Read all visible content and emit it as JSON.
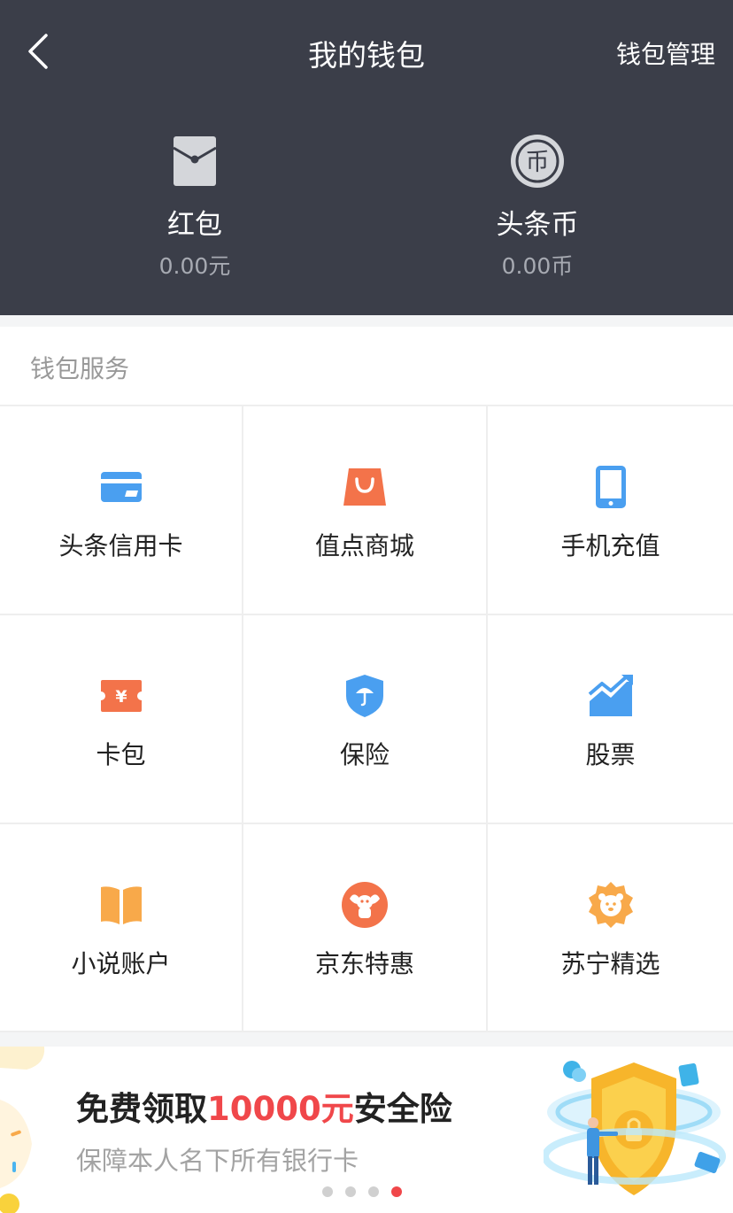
{
  "header": {
    "title": "我的钱包",
    "manage_label": "钱包管理",
    "red_packet": {
      "name": "红包",
      "value": "0.00元"
    },
    "coin": {
      "name": "头条币",
      "value": "0.00币",
      "icon_glyph": "币"
    }
  },
  "services": {
    "title": "钱包服务",
    "items": [
      {
        "label": "头条信用卡",
        "icon": "credit-card-icon",
        "color": "#4a9ff0"
      },
      {
        "label": "值点商城",
        "icon": "shopping-bag-icon",
        "color": "#f3734a"
      },
      {
        "label": "手机充值",
        "icon": "phone-icon",
        "color": "#4a9ff0"
      },
      {
        "label": "卡包",
        "icon": "coupon-icon",
        "color": "#f3734a",
        "glyph": "¥"
      },
      {
        "label": "保险",
        "icon": "shield-umbrella-icon",
        "color": "#4a9ff0"
      },
      {
        "label": "股票",
        "icon": "stock-chart-icon",
        "color": "#4a9ff0"
      },
      {
        "label": "小说账户",
        "icon": "book-icon",
        "color": "#f8a94a"
      },
      {
        "label": "京东特惠",
        "icon": "jd-dog-icon",
        "color": "#f3734a"
      },
      {
        "label": "苏宁精选",
        "icon": "suning-lion-icon",
        "color": "#f8a94a"
      }
    ]
  },
  "banner": {
    "title_prefix": "免费领取",
    "title_highlight": "10000元",
    "title_suffix": "安全险",
    "subtitle": "保障本人名下所有银行卡",
    "dots_count": 4,
    "active_dot": 4,
    "highlight_color": "#f0474a"
  }
}
